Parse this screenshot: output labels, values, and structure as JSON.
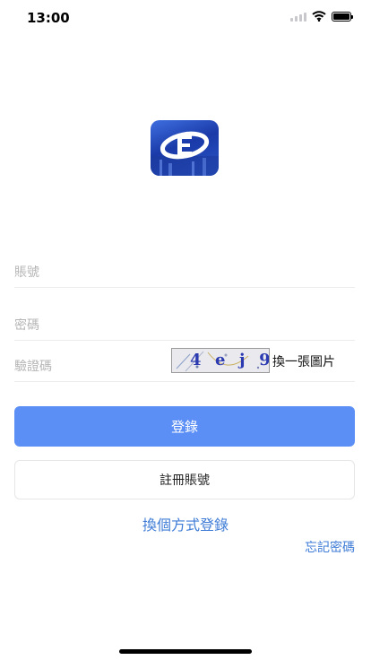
{
  "status_bar": {
    "time": "13:00"
  },
  "form": {
    "account_placeholder": "賬號",
    "password_placeholder": "密碼",
    "captcha_placeholder": "驗證碼",
    "captcha_text": "4  e  j  9",
    "refresh_captcha_label": "換一張圖片"
  },
  "actions": {
    "login_label": "登錄",
    "register_label": "註冊賬號",
    "switch_login_label": "換個方式登錄",
    "forgot_password_label": "忘記密碼"
  },
  "colors": {
    "primary": "#5b8ff5",
    "link": "#3d7bd6"
  }
}
